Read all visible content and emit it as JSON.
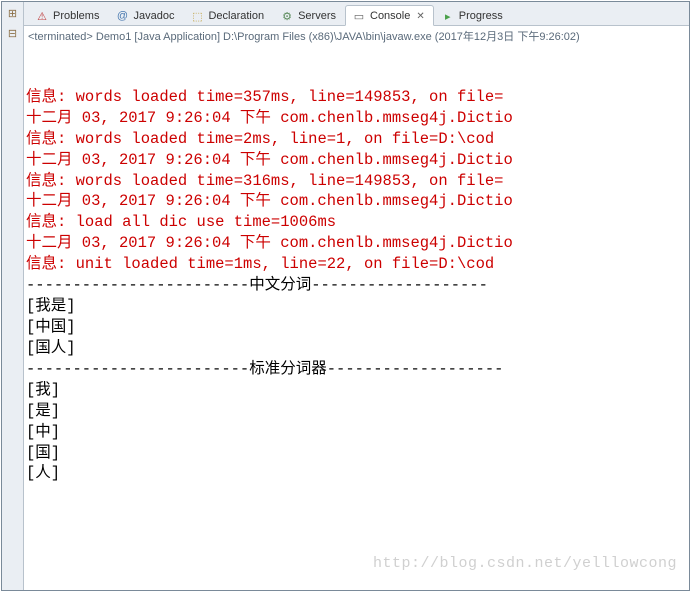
{
  "toolbar": {
    "icon1": "⊞",
    "icon2": "⊟"
  },
  "tabs": [
    {
      "icon": "⚠",
      "label": "Problems",
      "iconClass": "problems-icon"
    },
    {
      "icon": "@",
      "label": "Javadoc",
      "iconClass": "javadoc-icon"
    },
    {
      "icon": "⬚",
      "label": "Declaration",
      "iconClass": "declaration-icon"
    },
    {
      "icon": "⚙",
      "label": "Servers",
      "iconClass": "servers-icon"
    },
    {
      "icon": "▭",
      "label": "Console",
      "iconClass": "console-icon",
      "active": true,
      "closable": true
    },
    {
      "icon": "▸",
      "label": "Progress",
      "iconClass": "progress-icon"
    }
  ],
  "status": "<terminated> Demo1 [Java Application] D:\\Program Files (x86)\\JAVA\\bin\\javaw.exe (2017年12月3日 下午9:26:02)",
  "lines": [
    {
      "cls": "red",
      "text": "信息: words loaded time=357ms, line=149853, on file="
    },
    {
      "cls": "red",
      "text": "十二月 03, 2017 9:26:04 下午 com.chenlb.mmseg4j.Dictio"
    },
    {
      "cls": "red",
      "text": "信息: words loaded time=2ms, line=1, on file=D:\\cod"
    },
    {
      "cls": "red",
      "text": "十二月 03, 2017 9:26:04 下午 com.chenlb.mmseg4j.Dictio"
    },
    {
      "cls": "red",
      "text": "信息: words loaded time=316ms, line=149853, on file="
    },
    {
      "cls": "red",
      "text": "十二月 03, 2017 9:26:04 下午 com.chenlb.mmseg4j.Dictio"
    },
    {
      "cls": "red",
      "text": "信息: load all dic use time=1006ms"
    },
    {
      "cls": "red",
      "text": "十二月 03, 2017 9:26:04 下午 com.chenlb.mmseg4j.Dictio"
    },
    {
      "cls": "red",
      "text": "信息: unit loaded time=1ms, line=22, on file=D:\\cod"
    },
    {
      "cls": "black",
      "text": "------------------------中文分词-------------------"
    },
    {
      "cls": "black",
      "text": "[我是]"
    },
    {
      "cls": "black",
      "text": "[中国]"
    },
    {
      "cls": "black",
      "text": "[国人]"
    },
    {
      "cls": "black",
      "text": "------------------------标准分词器-------------------"
    },
    {
      "cls": "black",
      "text": "[我]"
    },
    {
      "cls": "black",
      "text": "[是]"
    },
    {
      "cls": "black",
      "text": "[中]"
    },
    {
      "cls": "black",
      "text": "[国]"
    },
    {
      "cls": "black",
      "text": "[人]"
    }
  ],
  "watermark": "http://blog.csdn.net/yelllowcong"
}
